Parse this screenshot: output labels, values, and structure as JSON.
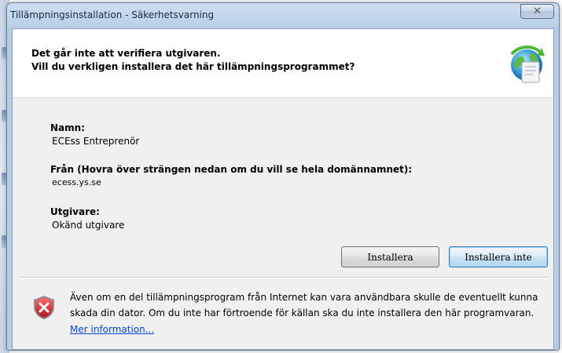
{
  "window": {
    "title": "Tillämpningsinstallation - Säkerhetsvarning",
    "close_symbol": "✕"
  },
  "header": {
    "line1": "Det går inte att verifiera utgivaren.",
    "line2": "Vill du verkligen installera det här tillämpningsprogrammet?",
    "icon": "clickonce-globe-icon"
  },
  "fields": {
    "name_label": "Namn:",
    "name_value": "ECEss Entreprenör",
    "from_label": "Från (Hovra över strängen nedan om du vill se hela domännamnet):",
    "from_value": "ecess.ys.se",
    "publisher_label": "Utgivare:",
    "publisher_value": "Okänd utgivare"
  },
  "buttons": {
    "install": "Installera",
    "dont_install": "Installera inte"
  },
  "warning": {
    "icon": "security-shield-icon",
    "line1": "Även om en del tillämpningsprogram från Internet kan vara användbara skulle de eventuellt kunna",
    "line2": "skada din dator. Om du inte har förtroende för källan ska du inte installera den här programvaran.",
    "link": "Mer information..."
  },
  "colors": {
    "link": "#0645c8",
    "shield_red": "#c8252c",
    "default_button_border": "#3c7fb1"
  }
}
